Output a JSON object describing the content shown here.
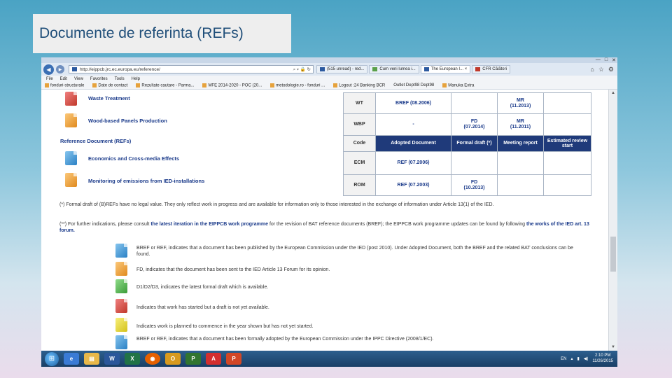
{
  "slide": {
    "title": "Documente de referinta (REFs)"
  },
  "browser": {
    "address": "http://eippcb.jrc.ec.europa.eu/reference/",
    "tabs": [
      {
        "label": "(515 unread) - red...",
        "active": false
      },
      {
        "label": "Cum veni lumea i...",
        "active": false
      },
      {
        "label": "The European I... ×",
        "active": true
      },
      {
        "label": "CFR Călători",
        "active": false
      }
    ],
    "menu": [
      "File",
      "Edit",
      "View",
      "Favorites",
      "Tools",
      "Help"
    ],
    "favorites": [
      "fonduri-structurale",
      "Date de contact",
      "Rezultate cautare - Parma...",
      "MFE 2014-2020 - POC (20...",
      "metodologie.ro - fonduri ...",
      "Logout :24 Banking BCR",
      "Outlet Dept98 Dept98",
      "Manuka Extra"
    ]
  },
  "left_links": {
    "waste_treatment": "Waste Treatment",
    "wood_panels": "Wood-based Panels Production",
    "section_refs": "Reference Document (REFs)",
    "economics": "Economics and Cross-media Effects",
    "monitoring": "Monitoring of emissions from IED-installations"
  },
  "table": {
    "rows_top": [
      {
        "code": "WT",
        "adopted": "BREF (08.2006)",
        "formal": "",
        "meeting": "MR\n(11.2013)",
        "review": ""
      },
      {
        "code": "WBP",
        "adopted": "-",
        "formal": "FD\n(07.2014)",
        "meeting": "MR\n(11.2011)",
        "review": ""
      }
    ],
    "header": {
      "code": "Code",
      "adopted": "Adopted Document",
      "formal": "Formal draft (*)",
      "meeting": "Meeting report",
      "review": "Estimated review start"
    },
    "rows_bottom": [
      {
        "code": "ECM",
        "adopted": "REF (07.2006)",
        "formal": "",
        "meeting": "",
        "review": ""
      },
      {
        "code": "ROM",
        "adopted": "REF (07.2003)",
        "formal": "FD\n(10.2013)",
        "meeting": "",
        "review": ""
      }
    ]
  },
  "notes": {
    "n1": "(*) Formal draft of (B)REFs have no legal value. They only reflect work in progress and are available for information only to those interested in the exchange of information under Article 13(1) of the IED.",
    "n2_a": "(**) For further indications, please consult ",
    "n2_b": "the latest iteration in the EIPPCB work programme",
    "n2_c": " for the revision of BAT reference documents (BREF); the EIPPCB work programme updates can be found by following ",
    "n2_d": "the works of the IED art. 13 forum."
  },
  "legend": {
    "blue": "BREF or REF, indicates that a document has been published by the European Commission under the IED (post 2010). Under Adopted Document, both the BREF and the related BAT conclusions can be found.",
    "orange": "FD, indicates that the document has been sent to the IED Article 13 Forum for its opinion.",
    "green": "D1/D2/D3, indicates the latest formal draft which is available.",
    "red": "Indicates that work has started but a draft is not yet available.",
    "yellow": "Indicates work is planned to commence in the year shown but has not yet started.",
    "blue2": "BREF or REF, indicates that a document has been formally adopted by the European Commission under the IPPC Directive (2008/1/EC)."
  },
  "taskbar": {
    "lang": "EN",
    "time": "2:10 PM",
    "date": "11/26/2015",
    "apps": [
      "IE",
      "Explorer",
      "Word",
      "Excel",
      "Firefox",
      "Outlook",
      "Project",
      "Acrobat",
      "PowerPoint"
    ]
  },
  "colors": {
    "table_header": "#1f3a7a",
    "link": "#1a3a8a",
    "title_text": "#1f4e79"
  }
}
